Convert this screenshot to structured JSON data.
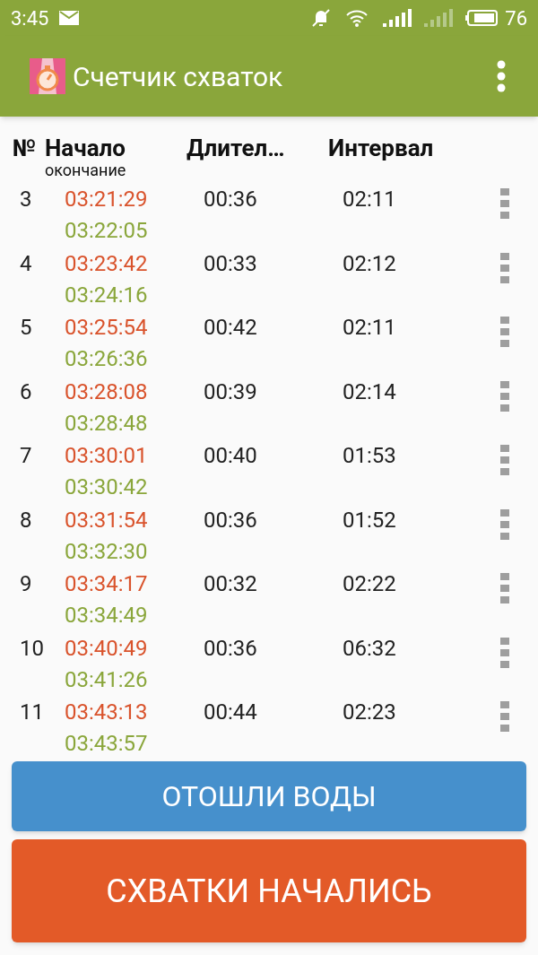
{
  "status_bar": {
    "time": "3:45",
    "battery": "76"
  },
  "app_bar": {
    "title": "Счетчик схваток"
  },
  "table": {
    "columns": [
      {
        "title": "№"
      },
      {
        "title": "Начало",
        "subtitle": "окончание"
      },
      {
        "title": "Длител…"
      },
      {
        "title": "Интервал"
      }
    ],
    "rows": [
      {
        "number": "3",
        "start": "03:21:29",
        "end": "03:22:05",
        "duration": "00:36",
        "interval": "02:11"
      },
      {
        "number": "4",
        "start": "03:23:42",
        "end": "03:24:16",
        "duration": "00:33",
        "interval": "02:12"
      },
      {
        "number": "5",
        "start": "03:25:54",
        "end": "03:26:36",
        "duration": "00:42",
        "interval": "02:11"
      },
      {
        "number": "6",
        "start": "03:28:08",
        "end": "03:28:48",
        "duration": "00:39",
        "interval": "02:14"
      },
      {
        "number": "7",
        "start": "03:30:01",
        "end": "03:30:42",
        "duration": "00:40",
        "interval": "01:53"
      },
      {
        "number": "8",
        "start": "03:31:54",
        "end": "03:32:30",
        "duration": "00:36",
        "interval": "01:52"
      },
      {
        "number": "9",
        "start": "03:34:17",
        "end": "03:34:49",
        "duration": "00:32",
        "interval": "02:22"
      },
      {
        "number": "10",
        "start": "03:40:49",
        "end": "03:41:26",
        "duration": "00:36",
        "interval": "06:32"
      },
      {
        "number": "11",
        "start": "03:43:13",
        "end": "03:43:57",
        "duration": "00:44",
        "interval": "02:23"
      }
    ]
  },
  "buttons": [
    {
      "label": "ОТОШЛИ ВОДЫ",
      "kind": "water"
    },
    {
      "label": "СХВАТКИ НАЧАЛИСЬ",
      "kind": "contractions"
    }
  ]
}
